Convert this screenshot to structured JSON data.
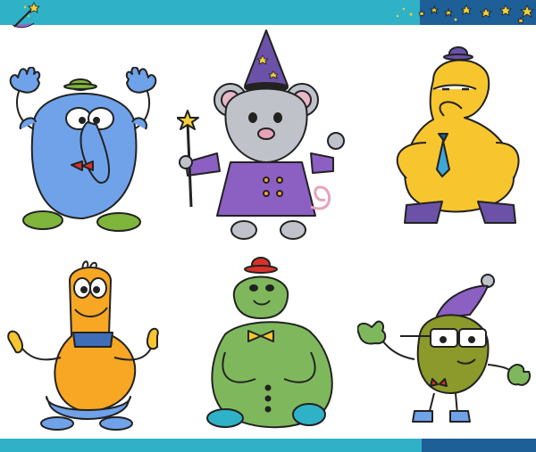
{
  "scene": {
    "description_free": true,
    "colors": {
      "banner": "#2fb2c7",
      "banner_dark": "#1e5f98",
      "background": "#ffffff",
      "star": "#f3d13a"
    },
    "characters": [
      {
        "id": "blue-creature",
        "icon": "blue-monster"
      },
      {
        "id": "wizard-mouse",
        "icon": "mouse-wizard"
      },
      {
        "id": "yellow-creature",
        "icon": "yellow-monster"
      },
      {
        "id": "orange-alien",
        "icon": "orange-alien"
      },
      {
        "id": "green-creature",
        "icon": "green-monster"
      },
      {
        "id": "olive-alien",
        "icon": "olive-alien"
      }
    ]
  }
}
